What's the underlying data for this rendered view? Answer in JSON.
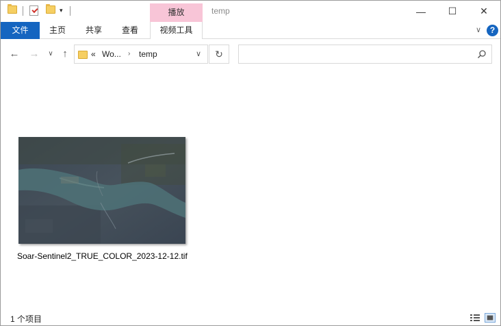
{
  "titlebar": {
    "contextual_tab": "播放",
    "title": "temp",
    "minimize_glyph": "—",
    "maximize_glyph": "☐",
    "close_glyph": "✕",
    "quick_access_dropdown": "▾"
  },
  "ribbon": {
    "tabs": [
      "文件",
      "主页",
      "共享",
      "查看",
      "视频工具"
    ],
    "collapse_glyph": "∨",
    "help_glyph": "?"
  },
  "nav": {
    "back_glyph": "←",
    "forward_glyph": "→",
    "recent_glyph": "∨",
    "up_glyph": "↑",
    "overflow_glyph": "«",
    "breadcrumbs": [
      "Wo...",
      "temp"
    ],
    "crumb_separator": "›",
    "address_dropdown_glyph": "∨",
    "refresh_glyph": "↻"
  },
  "search": {
    "placeholder": "",
    "value": ""
  },
  "files": [
    {
      "name": "Soar-Sentinel2_TRUE_COLOR_2023-12-12.tif",
      "type": "tif image thumbnail"
    }
  ],
  "status": {
    "item_count": "1 个项目"
  },
  "icons": {
    "folder": "folder-icon",
    "properties": "properties-icon",
    "search": "search-icon",
    "details_view": "details-view-icon",
    "large_icons_view": "large-icons-view-icon"
  },
  "colors": {
    "file_tab": "#1565c0",
    "contextual_tab": "#f8c5d7",
    "folder": "#f6cf63",
    "border": "#d9d9d9"
  }
}
